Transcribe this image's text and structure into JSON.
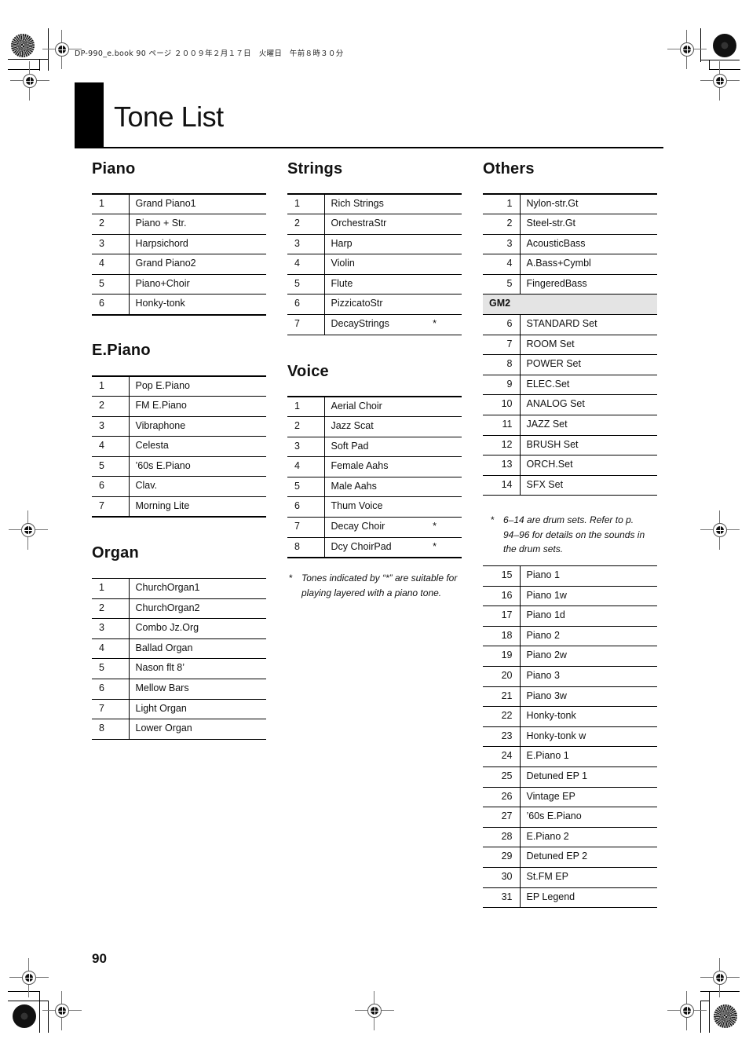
{
  "print_header": "DP-990_e.book 90 ページ ２００９年２月１７日　火曜日　午前８時３０分",
  "page_title": "Tone List",
  "page_number": "90",
  "sections": {
    "piano": {
      "title": "Piano",
      "rows": [
        {
          "num": "1",
          "name": "Grand Piano1"
        },
        {
          "num": "2",
          "name": "Piano + Str."
        },
        {
          "num": "3",
          "name": "Harpsichord"
        },
        {
          "num": "4",
          "name": "Grand Piano2"
        },
        {
          "num": "5",
          "name": "Piano+Choir"
        },
        {
          "num": "6",
          "name": "Honky-tonk"
        }
      ]
    },
    "epiano": {
      "title": "E.Piano",
      "rows": [
        {
          "num": "1",
          "name": "Pop E.Piano"
        },
        {
          "num": "2",
          "name": "FM E.Piano"
        },
        {
          "num": "3",
          "name": "Vibraphone"
        },
        {
          "num": "4",
          "name": "Celesta"
        },
        {
          "num": "5",
          "name": "’60s E.Piano"
        },
        {
          "num": "6",
          "name": "Clav."
        },
        {
          "num": "7",
          "name": "Morning Lite"
        }
      ]
    },
    "organ": {
      "title": "Organ",
      "rows": [
        {
          "num": "1",
          "name": "ChurchOrgan1"
        },
        {
          "num": "2",
          "name": "ChurchOrgan2"
        },
        {
          "num": "3",
          "name": "Combo Jz.Org"
        },
        {
          "num": "4",
          "name": "Ballad Organ"
        },
        {
          "num": "5",
          "name": "Nason flt 8’"
        },
        {
          "num": "6",
          "name": "Mellow Bars"
        },
        {
          "num": "7",
          "name": "Light Organ"
        },
        {
          "num": "8",
          "name": "Lower Organ"
        }
      ]
    },
    "strings": {
      "title": "Strings",
      "rows": [
        {
          "num": "1",
          "name": "Rich Strings",
          "mark": ""
        },
        {
          "num": "2",
          "name": "OrchestraStr",
          "mark": ""
        },
        {
          "num": "3",
          "name": "Harp",
          "mark": ""
        },
        {
          "num": "4",
          "name": "Violin",
          "mark": ""
        },
        {
          "num": "5",
          "name": "Flute",
          "mark": ""
        },
        {
          "num": "6",
          "name": "PizzicatoStr",
          "mark": ""
        },
        {
          "num": "7",
          "name": "DecayStrings",
          "mark": "*"
        }
      ]
    },
    "voice": {
      "title": "Voice",
      "rows": [
        {
          "num": "1",
          "name": "Aerial Choir",
          "mark": ""
        },
        {
          "num": "2",
          "name": "Jazz Scat",
          "mark": ""
        },
        {
          "num": "3",
          "name": "Soft Pad",
          "mark": ""
        },
        {
          "num": "4",
          "name": "Female Aahs",
          "mark": ""
        },
        {
          "num": "5",
          "name": "Male Aahs",
          "mark": ""
        },
        {
          "num": "6",
          "name": "Thum Voice",
          "mark": ""
        },
        {
          "num": "7",
          "name": "Decay Choir",
          "mark": "*"
        },
        {
          "num": "8",
          "name": "Dcy ChoirPad",
          "mark": "*"
        }
      ],
      "note_marker": "*",
      "note": "Tones indicated by “*” are suitable for playing layered with a piano tone."
    },
    "others": {
      "title": "Others",
      "rows_a": [
        {
          "num": "1",
          "name": "Nylon-str.Gt"
        },
        {
          "num": "2",
          "name": "Steel-str.Gt"
        },
        {
          "num": "3",
          "name": "AcousticBass"
        },
        {
          "num": "4",
          "name": "A.Bass+Cymbl"
        },
        {
          "num": "5",
          "name": "FingeredBass"
        }
      ],
      "group_label": "GM2",
      "rows_b": [
        {
          "num": "6",
          "name": "STANDARD Set"
        },
        {
          "num": "7",
          "name": "ROOM Set"
        },
        {
          "num": "8",
          "name": "POWER Set"
        },
        {
          "num": "9",
          "name": "ELEC.Set"
        },
        {
          "num": "10",
          "name": "ANALOG Set"
        },
        {
          "num": "11",
          "name": "JAZZ Set"
        },
        {
          "num": "12",
          "name": "BRUSH Set"
        },
        {
          "num": "13",
          "name": "ORCH.Set"
        },
        {
          "num": "14",
          "name": "SFX Set"
        }
      ],
      "note_marker": "*",
      "note": "6–14 are drum sets. Refer to p. 94–96 for details on the sounds in the drum sets.",
      "rows_c": [
        {
          "num": "15",
          "name": "Piano 1"
        },
        {
          "num": "16",
          "name": "Piano 1w"
        },
        {
          "num": "17",
          "name": "Piano 1d"
        },
        {
          "num": "18",
          "name": "Piano 2"
        },
        {
          "num": "19",
          "name": "Piano 2w"
        },
        {
          "num": "20",
          "name": "Piano 3"
        },
        {
          "num": "21",
          "name": "Piano 3w"
        },
        {
          "num": "22",
          "name": "Honky-tonk"
        },
        {
          "num": "23",
          "name": "Honky-tonk w"
        },
        {
          "num": "24",
          "name": "E.Piano 1"
        },
        {
          "num": "25",
          "name": "Detuned EP 1"
        },
        {
          "num": "26",
          "name": "Vintage EP"
        },
        {
          "num": "27",
          "name": "’60s E.Piano"
        },
        {
          "num": "28",
          "name": "E.Piano 2"
        },
        {
          "num": "29",
          "name": "Detuned EP 2"
        },
        {
          "num": "30",
          "name": "St.FM EP"
        },
        {
          "num": "31",
          "name": "EP Legend"
        }
      ]
    }
  }
}
